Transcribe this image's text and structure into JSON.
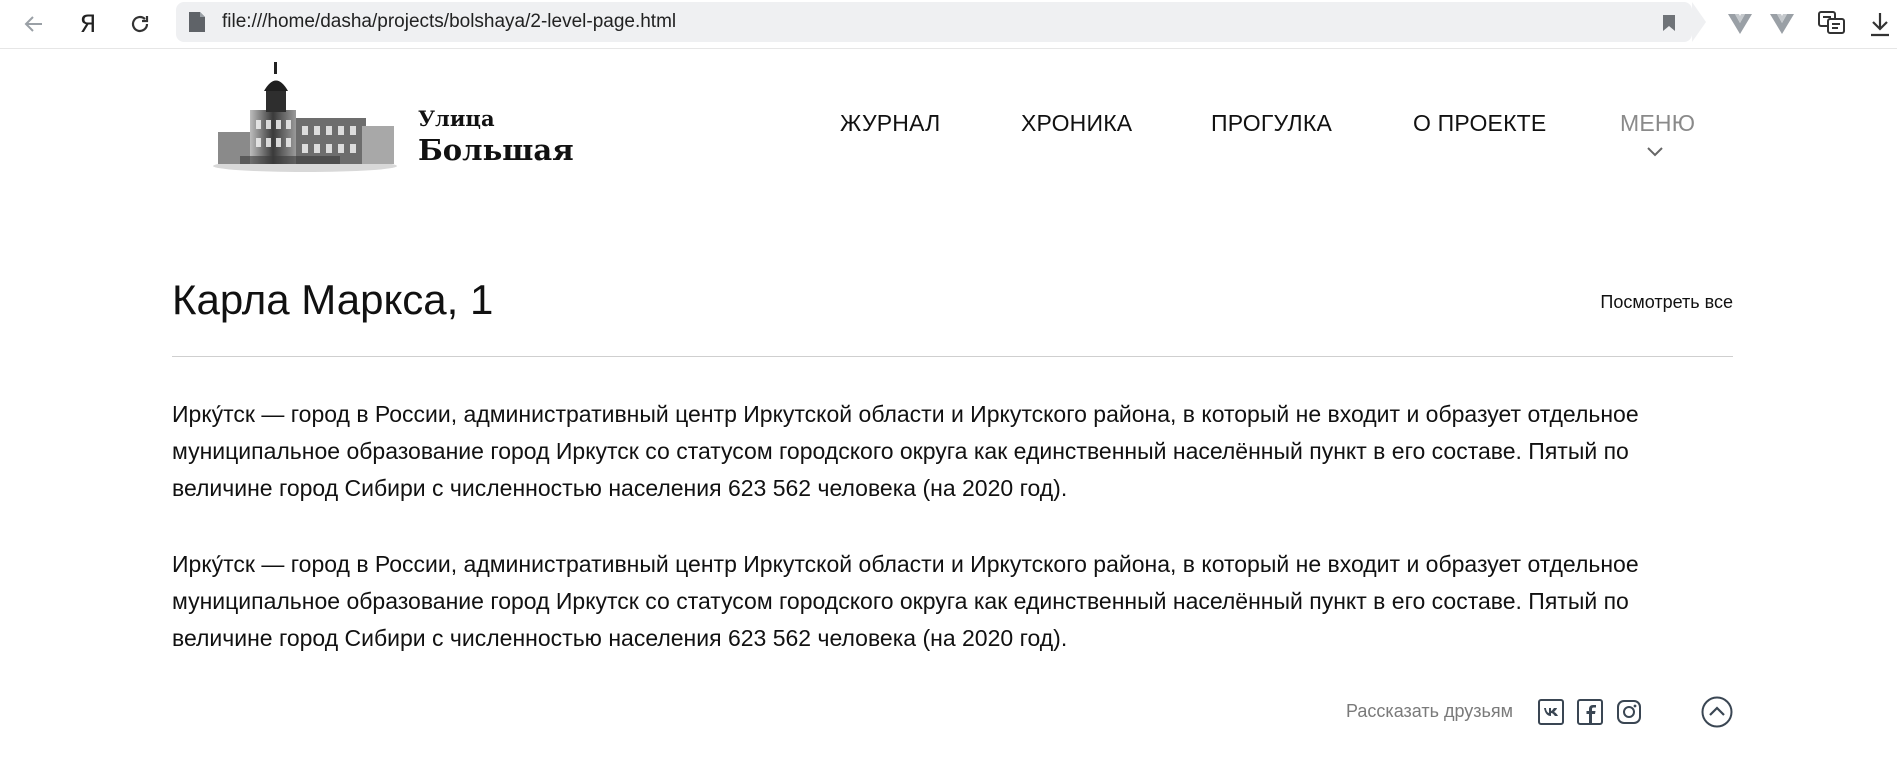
{
  "browser": {
    "address": "file:///home/dasha/projects/bolshaya/2-level-page.html",
    "yandex_glyph": "Я"
  },
  "logo": {
    "line1": "Улица",
    "line2": "Большая"
  },
  "nav": {
    "items": [
      "ЖУРНАЛ",
      "ХРОНИКА",
      "ПРОГУЛКА",
      "О ПРОЕКТЕ"
    ],
    "menu_label": "МЕНЮ"
  },
  "main": {
    "title": "Карла Маркса, 1",
    "view_all": "Посмотреть все",
    "paragraphs": [
      "Ирку́тск — город в России, административный центр Иркутской области и Иркутского района, в который не входит и образует отдельное муниципальное образование город Иркутск со статусом городского округа как единственный населённый пункт в его составе. Пятый по величине город Сибири с численностью населения 623 562 человека (на 2020 год).",
      "Ирку́тск — город в России, административный центр Иркутской области и Иркутского района, в который не входит и образует отдельное муниципальное образование город Иркутск со статусом городского округа как единственный населённый пункт в его составе. Пятый по величине город Сибири с численностью населения 623 562 человека (на 2020 год)."
    ]
  },
  "footer": {
    "share_label": "Рассказать друзьям",
    "socials": [
      "vk-icon",
      "facebook-icon",
      "instagram-icon"
    ]
  },
  "colors": {
    "menu_gray": "#8a8a8a",
    "share_gray": "#7a7a7a",
    "icon_dark": "#3a4653"
  }
}
